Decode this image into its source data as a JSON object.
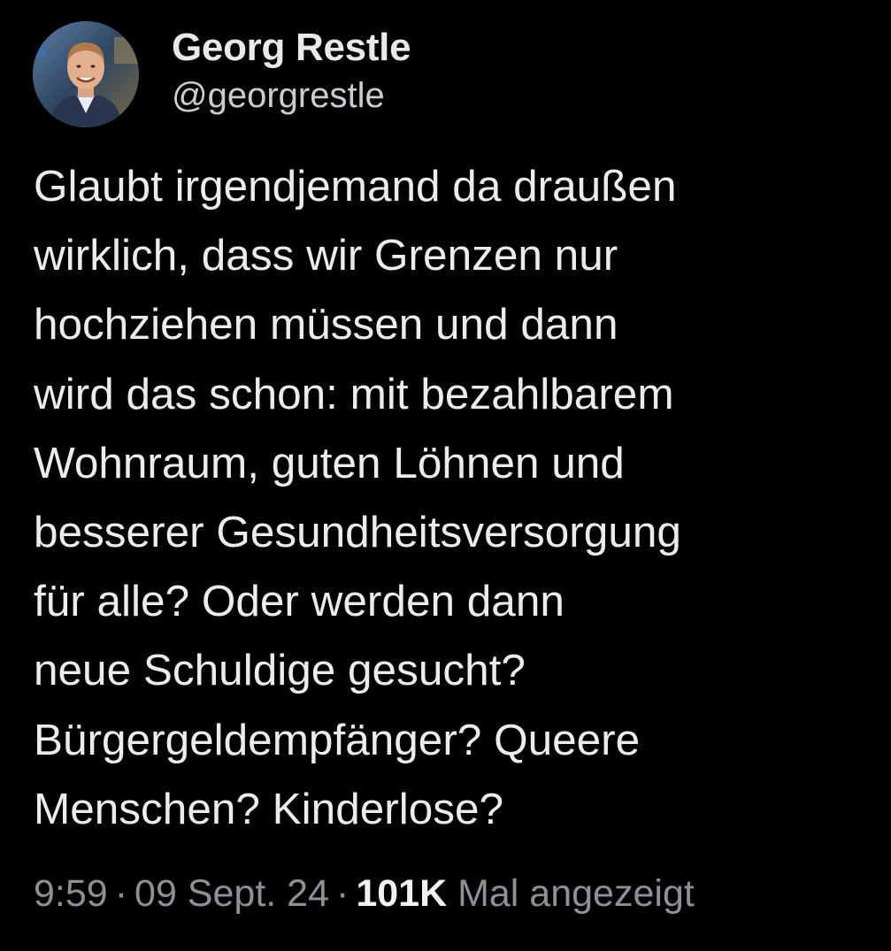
{
  "author": {
    "display_name": "Georg Restle",
    "handle": "@georgrestle"
  },
  "tweet": {
    "text": "Glaubt irgendjemand da draußen\nwirklich, dass wir Grenzen nur\nhochziehen müssen und dann\nwird das schon: mit bezahlbarem\nWohnraum, guten Löhnen und\nbesserer Gesundheitsversorgung\nfür alle? Oder werden dann\nneue Schuldige gesucht?\nBürgergeldempfänger? Queere\nMenschen? Kinderlose?"
  },
  "meta": {
    "time": "9:59",
    "separator": "·",
    "date": "09 Sept. 24",
    "views_count": "101K",
    "views_label": "Mal angezeigt"
  },
  "colors": {
    "background": "#000000",
    "primary_text": "#e7e9ea",
    "secondary_text": "#8b9197"
  },
  "icons": {
    "avatar": "profile-photo"
  }
}
